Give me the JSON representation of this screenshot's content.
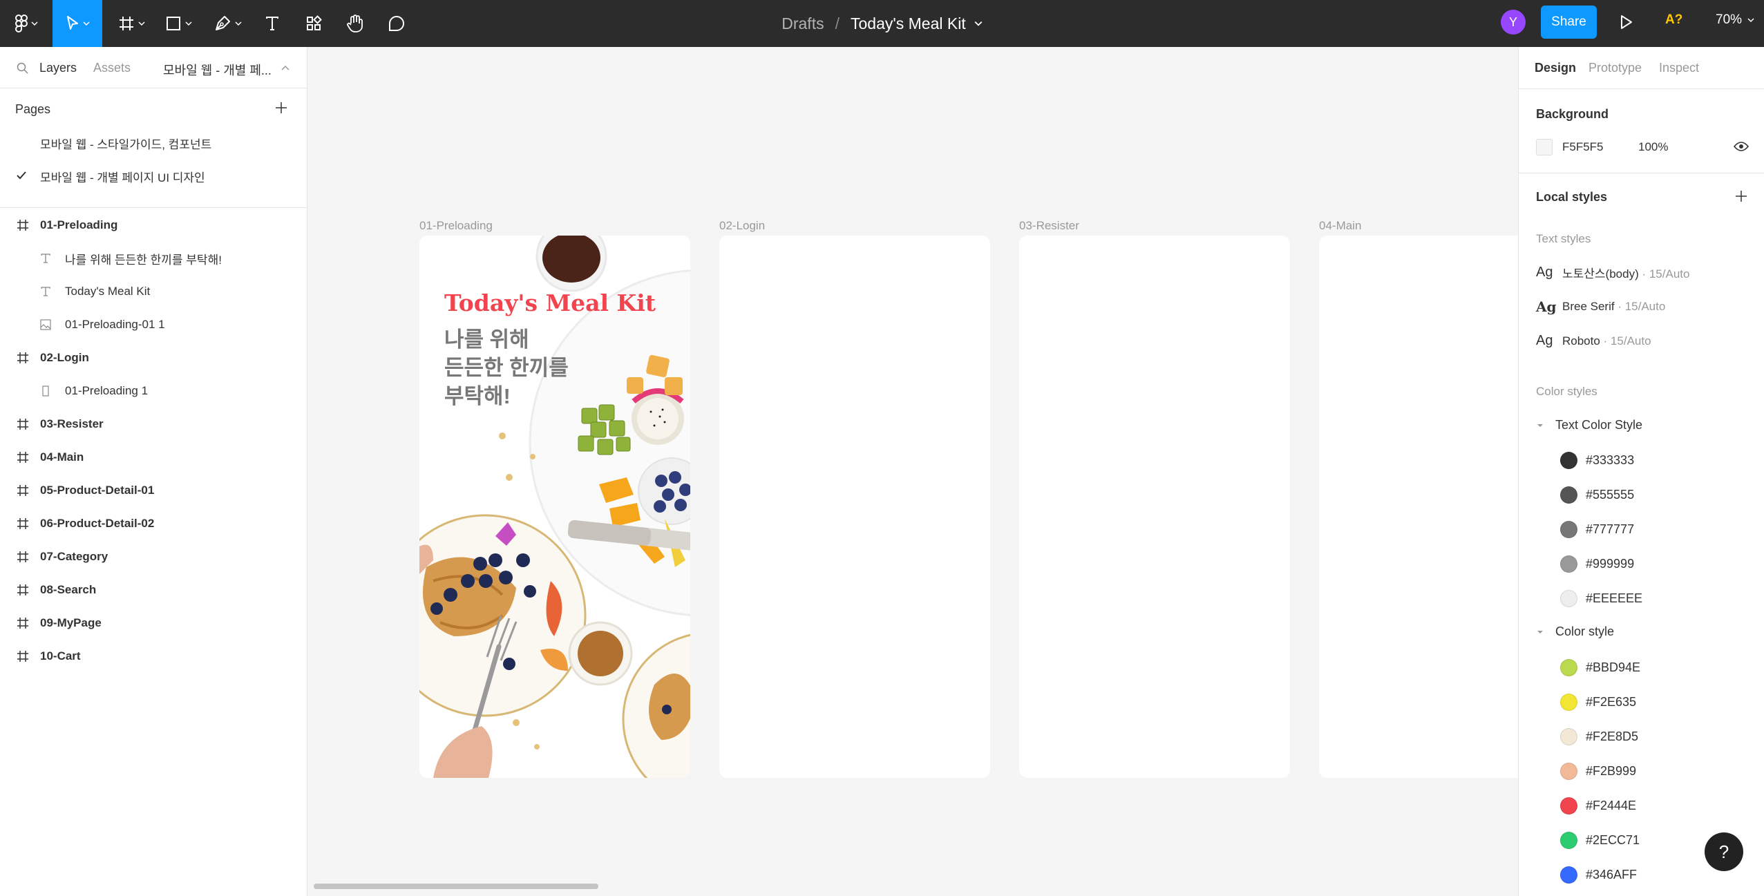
{
  "toolbar": {
    "drafts": "Drafts",
    "separator": "/",
    "file_name": "Today's Meal Kit",
    "avatar_initial": "Y",
    "share_label": "Share",
    "font_warning": "A?",
    "zoom": "70%"
  },
  "left_panel": {
    "tabs": {
      "layers": "Layers",
      "assets": "Assets",
      "page_select": "모바일 웹 - 개별 페..."
    },
    "pages_header": "Pages",
    "pages": [
      {
        "label": "모바일 웹 - 스타일가이드, 컴포넌트",
        "selected": false
      },
      {
        "label": "모바일 웹 - 개별 페이지 UI 디자인",
        "selected": true
      }
    ],
    "layers": [
      {
        "name": "01-Preloading",
        "type": "frame"
      },
      {
        "name": "나를 위해 든든한 한끼를 부탁해!",
        "type": "text"
      },
      {
        "name": "Today's Meal Kit",
        "type": "text"
      },
      {
        "name": "01-Preloading-01 1",
        "type": "image"
      },
      {
        "name": "02-Login",
        "type": "frame"
      },
      {
        "name": "01-Preloading 1",
        "type": "rect"
      },
      {
        "name": "03-Resister",
        "type": "frame"
      },
      {
        "name": "04-Main",
        "type": "frame"
      },
      {
        "name": "05-Product-Detail-01",
        "type": "frame"
      },
      {
        "name": "06-Product-Detail-02",
        "type": "frame"
      },
      {
        "name": "07-Category",
        "type": "frame"
      },
      {
        "name": "08-Search",
        "type": "frame"
      },
      {
        "name": "09-MyPage",
        "type": "frame"
      },
      {
        "name": "10-Cart",
        "type": "frame"
      }
    ]
  },
  "canvas": {
    "frames": [
      {
        "label": "01-Preloading"
      },
      {
        "label": "02-Login"
      },
      {
        "label": "03-Resister"
      },
      {
        "label": "04-Main"
      }
    ],
    "preloading": {
      "title": "Today's Meal Kit",
      "subtitle_lines": [
        "나를 위해",
        "든든한 한끼를",
        "부탁해!"
      ]
    }
  },
  "right_panel": {
    "tabs": {
      "design": "Design",
      "prototype": "Prototype",
      "inspect": "Inspect"
    },
    "background_header": "Background",
    "background": {
      "hex": "F5F5F5",
      "opacity": "100%",
      "color": "#F5F5F5"
    },
    "local_styles_header": "Local styles",
    "text_styles_header": "Text styles",
    "text_styles": [
      {
        "ag": "Ag",
        "name": "노토산스(body)",
        "meta": " · 15/Auto"
      },
      {
        "ag": "Ag",
        "name": "Bree Serif",
        "meta": " · 15/Auto"
      },
      {
        "ag": "Ag",
        "name": "Roboto",
        "meta": " · 15/Auto"
      }
    ],
    "color_styles_header": "Color styles",
    "text_color_group": "Text Color Style",
    "text_colors": [
      {
        "label": "#333333",
        "color": "#333333"
      },
      {
        "label": "#555555",
        "color": "#555555"
      },
      {
        "label": "#777777",
        "color": "#777777"
      },
      {
        "label": "#999999",
        "color": "#999999"
      },
      {
        "label": "#EEEEEE",
        "color": "#EEEEEE"
      }
    ],
    "color_group": "Color style",
    "colors": [
      {
        "label": "#BBD94E",
        "color": "#BBD94E"
      },
      {
        "label": "#F2E635",
        "color": "#F2E635"
      },
      {
        "label": "#F2E8D5",
        "color": "#F2E8D5"
      },
      {
        "label": "#F2B999",
        "color": "#F2B999"
      },
      {
        "label": "#F2444E",
        "color": "#F2444E"
      },
      {
        "label": "#2ECC71",
        "color": "#2ECC71"
      },
      {
        "label": "#346AFF",
        "color": "#346AFF"
      }
    ]
  },
  "help_label": "?"
}
